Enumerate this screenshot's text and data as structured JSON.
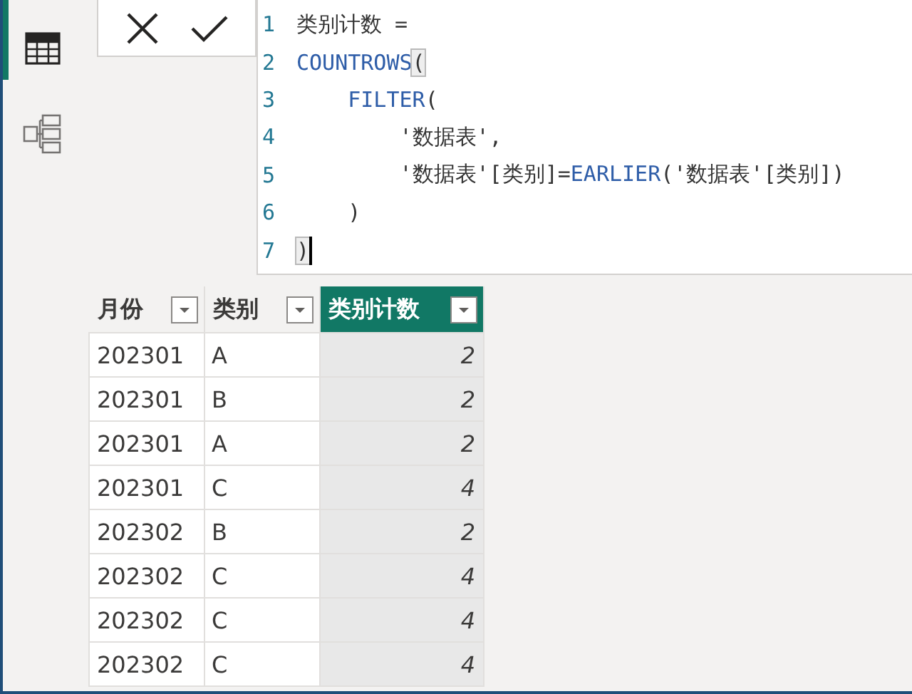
{
  "rail": {
    "items": [
      {
        "kind": "table",
        "selected": true
      },
      {
        "kind": "model",
        "selected": false
      }
    ]
  },
  "formula_bar": {
    "buttons": [
      {
        "kind": "cancel"
      },
      {
        "kind": "commit"
      }
    ],
    "lines": [
      {
        "number": "1",
        "cursor": false,
        "tokens": [
          {
            "text": "类别计数 =",
            "kind": "plain"
          }
        ]
      },
      {
        "number": "2",
        "cursor": false,
        "tokens": [
          {
            "text": "COUNTROWS",
            "kind": "function"
          },
          {
            "text": "(",
            "kind": "match"
          }
        ]
      },
      {
        "number": "3",
        "cursor": false,
        "tokens": [
          {
            "text": "    FILTER",
            "kind": "function"
          },
          {
            "text": "(",
            "kind": "plain"
          }
        ]
      },
      {
        "number": "4",
        "cursor": false,
        "tokens": [
          {
            "text": "        '数据表',",
            "kind": "plain"
          }
        ]
      },
      {
        "number": "5",
        "cursor": false,
        "tokens": [
          {
            "text": "        '数据表'[类别]=",
            "kind": "plain"
          },
          {
            "text": "EARLIER",
            "kind": "function"
          },
          {
            "text": "('数据表'[类别])",
            "kind": "plain"
          }
        ]
      },
      {
        "number": "6",
        "cursor": false,
        "tokens": [
          {
            "text": "    )",
            "kind": "plain"
          }
        ]
      },
      {
        "number": "7",
        "cursor": true,
        "tokens": [
          {
            "text": ")",
            "kind": "match"
          }
        ]
      }
    ]
  },
  "table": {
    "columns": [
      {
        "label": "月份",
        "selected": false,
        "kind": "text"
      },
      {
        "label": "类别",
        "selected": false,
        "kind": "text"
      },
      {
        "label": "类别计数",
        "selected": true,
        "kind": "number"
      }
    ],
    "rows": [
      [
        "202301",
        "A",
        "2"
      ],
      [
        "202301",
        "B",
        "2"
      ],
      [
        "202301",
        "A",
        "2"
      ],
      [
        "202301",
        "C",
        "4"
      ],
      [
        "202302",
        "B",
        "2"
      ],
      [
        "202302",
        "C",
        "4"
      ],
      [
        "202302",
        "C",
        "4"
      ],
      [
        "202302",
        "C",
        "4"
      ]
    ]
  }
}
